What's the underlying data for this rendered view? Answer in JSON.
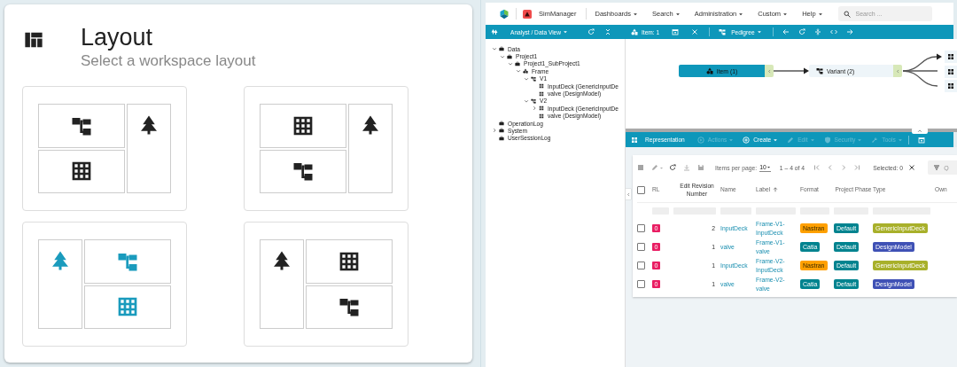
{
  "layout_panel": {
    "title": "Layout",
    "subtitle": "Select a workspace layout",
    "options": [
      {
        "kind": "right",
        "panels": [
          {
            "kind": "hierarchy"
          },
          {
            "kind": "grid"
          }
        ],
        "selected": false
      },
      {
        "kind": "right",
        "panels": [
          {
            "kind": "grid"
          },
          {
            "kind": "hierarchy"
          }
        ],
        "selected": false
      },
      {
        "kind": "left",
        "panels": [
          {
            "kind": "hierarchy"
          },
          {
            "kind": "grid"
          }
        ],
        "selected": true
      },
      {
        "kind": "left",
        "panels": [
          {
            "kind": "grid"
          },
          {
            "kind": "hierarchy"
          }
        ],
        "selected": false
      }
    ]
  },
  "app": {
    "nav": {
      "app_name": "SimManager",
      "menus": [
        "Dashboards",
        "Search",
        "Administration",
        "Custom",
        "Help"
      ],
      "search": {
        "placeholder": "Search ..."
      }
    },
    "tree_pane": {
      "view": "Analyst / Data View",
      "nodes": [
        {
          "label": "Data",
          "kind": "folder",
          "expandable": true,
          "expanded": true,
          "children": [
            {
              "label": "Project1",
              "kind": "folder",
              "expandable": true,
              "expanded": true,
              "children": [
                {
                  "label": "Project1_SubProject1",
                  "kind": "folder",
                  "expandable": true,
                  "expanded": true,
                  "children": [
                    {
                      "label": "Frame",
                      "kind": "structure",
                      "expandable": true,
                      "expanded": true,
                      "children": [
                        {
                          "label": "V1",
                          "kind": "variant",
                          "expandable": true,
                          "expanded": true,
                          "children": [
                            {
                              "label": "InputDeck (GenericInputDe",
                              "kind": "model",
                              "expandable": false,
                              "expanded": false
                            },
                            {
                              "label": "valve (DesignModel)",
                              "kind": "model",
                              "expandable": false,
                              "expanded": false
                            }
                          ]
                        },
                        {
                          "label": "V2",
                          "kind": "variant",
                          "expandable": true,
                          "expanded": true,
                          "children": [
                            {
                              "label": "InputDeck (GenericInputDe",
                              "kind": "model",
                              "expandable": true,
                              "expanded": false
                            },
                            {
                              "label": "valve (DesignModel)",
                              "kind": "model",
                              "expandable": false,
                              "expanded": false
                            }
                          ]
                        }
                      ]
                    }
                  ]
                }
              ]
            }
          ]
        },
        {
          "label": "OperationLog",
          "kind": "folder",
          "expandable": false,
          "expanded": false
        },
        {
          "label": "System",
          "kind": "folder",
          "expandable": true,
          "expanded": false
        },
        {
          "label": "UserSessionLog",
          "kind": "folder",
          "expandable": false,
          "expanded": false
        }
      ]
    },
    "graph_pane": {
      "item_label": "Item: 1",
      "view": "Pedigree",
      "nodes": [
        {
          "label": "Item (1)",
          "kind": "item"
        },
        {
          "label": "Variant (2)",
          "kind": "variant"
        }
      ]
    },
    "representation_bar": {
      "title": "Representation",
      "actions": [
        {
          "label": "Actions",
          "kind": "run",
          "disabled": true
        },
        {
          "label": "Create",
          "kind": "create",
          "disabled": false
        },
        {
          "label": "Edit",
          "kind": "edit",
          "disabled": true
        },
        {
          "label": "Security",
          "kind": "security",
          "disabled": true
        },
        {
          "label": "Tools",
          "kind": "tools",
          "disabled": true
        }
      ]
    },
    "table": {
      "items_per_page_label": "Items per page:",
      "items_per_page": "10",
      "range": "1 – 4 of 4",
      "selected_label": "Selected: 0",
      "filter_placeholder": "Q",
      "select_all_checked": false,
      "columns": [
        {
          "label": "RL",
          "sorted": false
        },
        {
          "label": "Edit Revision Number",
          "sorted": false
        },
        {
          "label": "Name",
          "sorted": false
        },
        {
          "label": "Label",
          "sorted": true
        },
        {
          "label": "Format",
          "sorted": false
        },
        {
          "label": "Project Phase",
          "sorted": false
        },
        {
          "label": "Type",
          "sorted": false
        },
        {
          "label": "Own",
          "sorted": false
        }
      ],
      "rows": [
        {
          "checked": false,
          "rl": "0",
          "revision": "2",
          "name": "InputDeck",
          "label": "Frame-V1-InputDeck",
          "format": {
            "text": "Nastran",
            "color": "#ffa000"
          },
          "phase": {
            "text": "Default",
            "color": "#00838f"
          },
          "type": {
            "text": "GenericInputDeck",
            "color": "#a8b02a"
          }
        },
        {
          "checked": false,
          "rl": "0",
          "revision": "1",
          "name": "valve",
          "label": "Frame-V1-valve",
          "format": {
            "text": "Catia",
            "color": "#00838f"
          },
          "phase": {
            "text": "Default",
            "color": "#00838f"
          },
          "type": {
            "text": "DesignModel",
            "color": "#3f51b5"
          }
        },
        {
          "checked": false,
          "rl": "0",
          "revision": "1",
          "name": "InputDeck",
          "label": "Frame-V2-InputDeck",
          "format": {
            "text": "Nastran",
            "color": "#ffa000"
          },
          "phase": {
            "text": "Default",
            "color": "#00838f"
          },
          "type": {
            "text": "GenericInputDeck",
            "color": "#a8b02a"
          }
        },
        {
          "checked": false,
          "rl": "0",
          "revision": "1",
          "name": "valve",
          "label": "Frame-V2-valve",
          "format": {
            "text": "Catia",
            "color": "#00838f"
          },
          "phase": {
            "text": "Default",
            "color": "#00838f"
          },
          "type": {
            "text": "DesignModel",
            "color": "#3f51b5"
          }
        }
      ]
    }
  }
}
